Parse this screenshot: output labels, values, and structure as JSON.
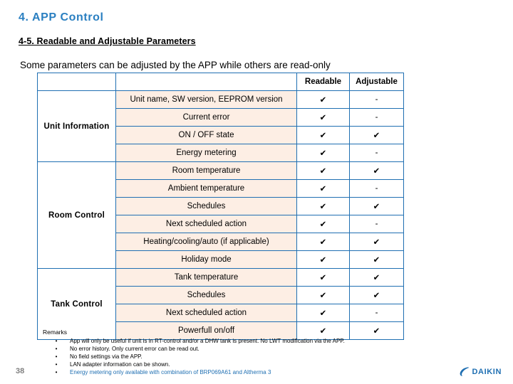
{
  "slide": {
    "title": "4. APP Control",
    "subtitle": "4-5. Readable and Adjustable Parameters",
    "lead": "Some parameters can be adjusted by the APP while others are read-only",
    "page_number": "38",
    "accent_color": "#2a7fc1",
    "row_color": "#fdeee4",
    "border_color": "#1f6fb2"
  },
  "table": {
    "headers": {
      "blank": "",
      "item": "",
      "readable": "Readable",
      "adjustable": "Adjustable"
    },
    "groups": [
      {
        "name": "Unit Information",
        "rows": [
          {
            "item": "Unit name, SW version, EEPROM version",
            "readable": "✔",
            "adjustable": "-"
          },
          {
            "item": "Current error",
            "readable": "✔",
            "adjustable": "-"
          },
          {
            "item": "ON / OFF state",
            "readable": "✔",
            "adjustable": "✔"
          },
          {
            "item": "Energy metering",
            "readable": "✔",
            "adjustable": "-"
          }
        ]
      },
      {
        "name": "Room Control",
        "rows": [
          {
            "item": "Room temperature",
            "readable": "✔",
            "adjustable": "✔"
          },
          {
            "item": "Ambient temperature",
            "readable": "✔",
            "adjustable": "-"
          },
          {
            "item": "Schedules",
            "readable": "✔",
            "adjustable": "✔"
          },
          {
            "item": "Next scheduled action",
            "readable": "✔",
            "adjustable": "-"
          },
          {
            "item": "Heating/cooling/auto (if applicable)",
            "readable": "✔",
            "adjustable": "✔"
          },
          {
            "item": "Holiday mode",
            "readable": "✔",
            "adjustable": "✔"
          }
        ]
      },
      {
        "name": "Tank Control",
        "rows": [
          {
            "item": "Tank temperature",
            "readable": "✔",
            "adjustable": "✔"
          },
          {
            "item": "Schedules",
            "readable": "✔",
            "adjustable": "✔"
          },
          {
            "item": "Next scheduled action",
            "readable": "✔",
            "adjustable": "-"
          },
          {
            "item": "Powerfull on/off",
            "readable": "✔",
            "adjustable": "✔"
          }
        ]
      }
    ]
  },
  "remarks": {
    "label": "Remarks",
    "bullet": "•",
    "items": [
      {
        "text": "App will only be useful if unit is in RT-control and/or a DHW tank is present. No LWT modification via the APP.",
        "highlight": false
      },
      {
        "text": "No error history. Only current error can be read out.",
        "highlight": false
      },
      {
        "text": "No field settings via the APP.",
        "highlight": false
      },
      {
        "text": "LAN adapter information can be shown.",
        "highlight": false
      },
      {
        "text": "Energy metering only available with combination of BRP069A61 and Altherma 3",
        "highlight": true
      }
    ]
  },
  "footer": {
    "brand": "DAIKIN"
  }
}
